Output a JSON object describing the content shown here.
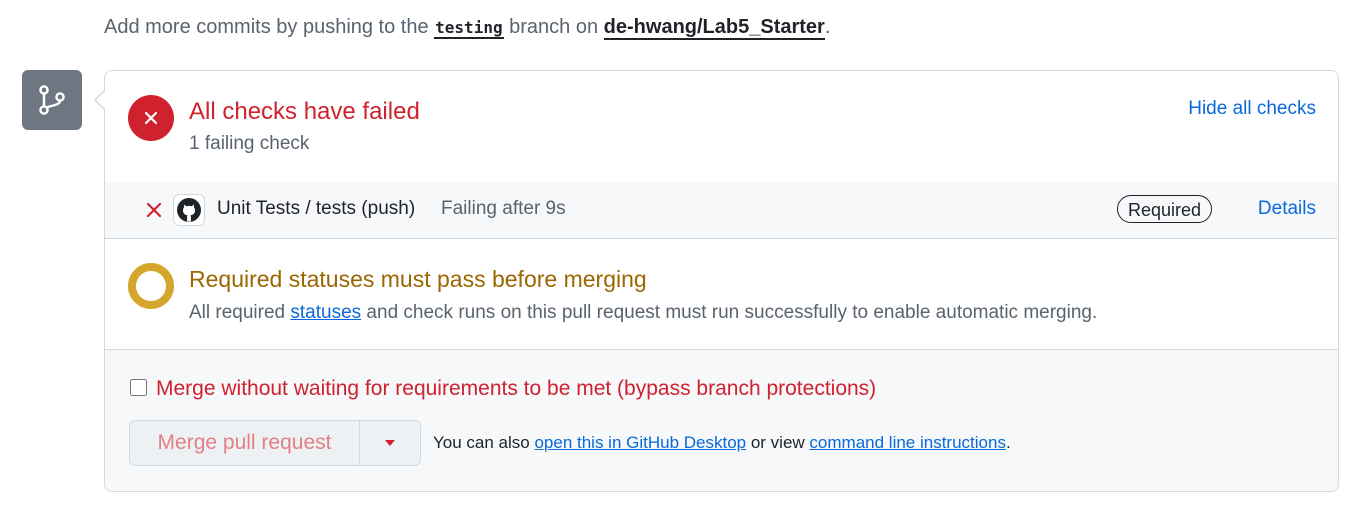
{
  "top_line": {
    "prefix": "Add more commits by pushing to the ",
    "branch": "testing",
    "middle": " branch on ",
    "repo": "de-hwang/Lab5_Starter",
    "suffix": "."
  },
  "checks": {
    "title": "All checks have failed",
    "subtitle": "1 failing check",
    "hide_link": "Hide all checks",
    "items": [
      {
        "name": "Unit Tests / tests (push)",
        "status": "Failing after 9s",
        "badge": "Required",
        "details_link": "Details",
        "icon": "x-icon",
        "avatar": "github-logo-icon"
      }
    ]
  },
  "statuses": {
    "title": "Required statuses must pass before merging",
    "sub_prefix": "All required ",
    "sub_link": "statuses",
    "sub_suffix": " and check runs on this pull request must run successfully to enable automatic merging."
  },
  "merge": {
    "bypass_label": "Merge without waiting for requirements to be met (bypass branch protections)",
    "bypass_checked": false,
    "button_label": "Merge pull request",
    "also_prefix": "You can also ",
    "desktop_link": "open this in GitHub Desktop",
    "also_middle": " or view ",
    "cli_link": "command line instructions",
    "also_suffix": "."
  },
  "colors": {
    "danger": "#cf222e",
    "attention": "#9a6700",
    "pending_ring": "#d4a72c",
    "link": "#0969da",
    "muted": "#59636e"
  },
  "icons": {
    "timeline": "git-branch-icon",
    "failed": "x-circle-icon",
    "pending": "pending-ring-icon",
    "dropdown": "triangle-down-icon"
  }
}
